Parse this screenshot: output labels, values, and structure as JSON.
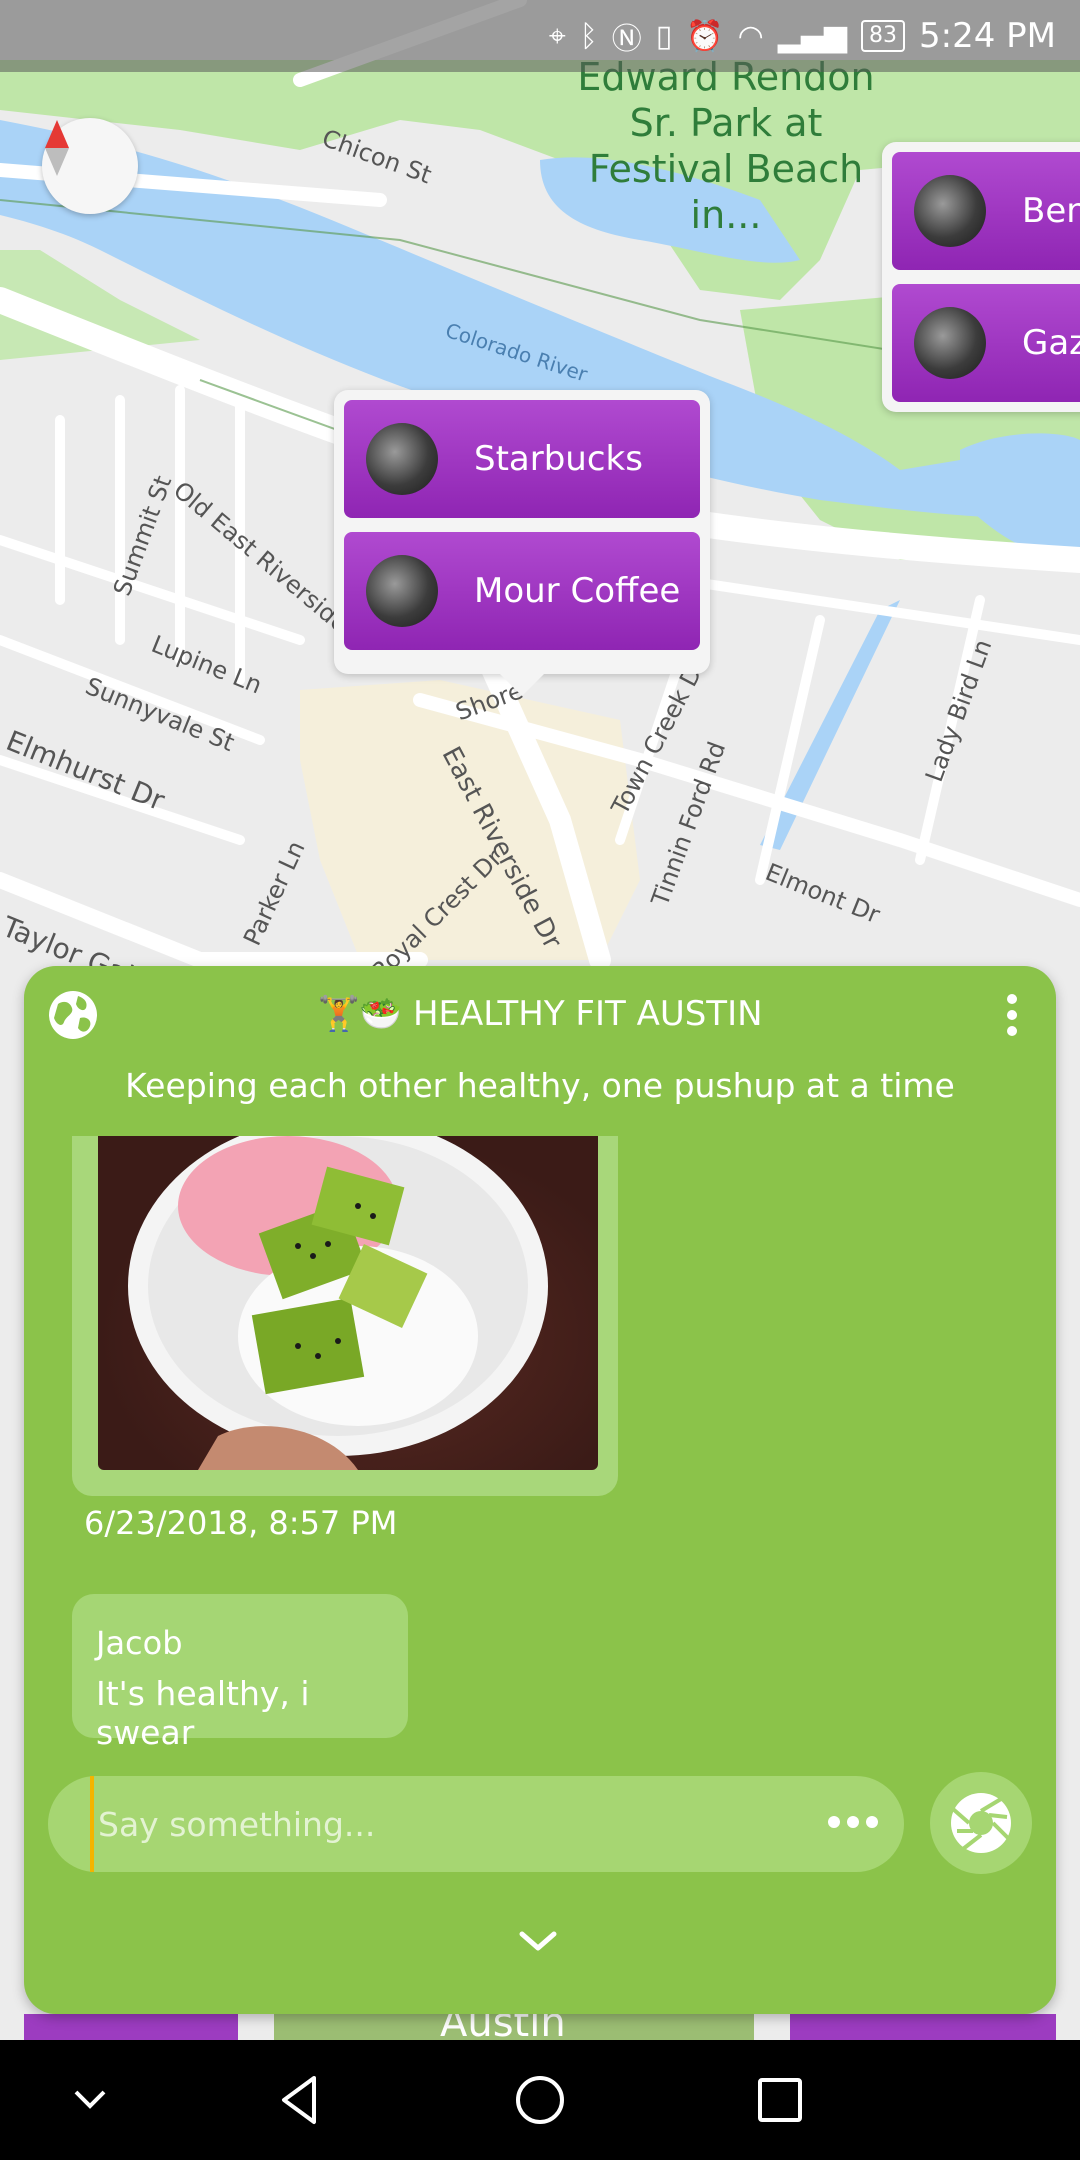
{
  "status_bar": {
    "battery": "83",
    "time": "5:24 PM",
    "icons": [
      "location-icon",
      "bluetooth-icon",
      "nfc-icon",
      "vibrate-icon",
      "alarm-icon",
      "wifi-icon",
      "signal-icon"
    ]
  },
  "map": {
    "street_labels": [
      "Chicon St",
      "Colorado River",
      "Old East Riverside Dr",
      "Summit St",
      "Lupine Ln",
      "Sunnyvale St",
      "Elmhurst Dr",
      "Taylor Gaines St",
      "Parker Ln",
      "Royal Crest Dr",
      "East Riverside Dr",
      "Shore",
      "Town Creek Dr",
      "Tinnin Ford Rd",
      "Lady Bird Ln",
      "Elmont Dr"
    ],
    "park_label": "Edward Rendon Sr. Park at Festival Beach in...",
    "popup_a": {
      "places": [
        {
          "name": "Starbucks"
        },
        {
          "name": "Mour Coffee"
        }
      ]
    },
    "popup_b": {
      "places": [
        {
          "name": "Ben"
        },
        {
          "name": "Gaz"
        }
      ]
    },
    "behind_label": "Austin"
  },
  "chat": {
    "title_emoji": "🏋️🥗",
    "title": "HEALTHY FIT AUSTIN",
    "subtitle": "Keeping each other healthy, one pushup at a time",
    "message_timestamp": "6/23/2018, 8:57 PM",
    "message": {
      "author": "Jacob",
      "text": "It's healthy, i swear"
    },
    "input_placeholder": "Say something..."
  },
  "colors": {
    "panel": "#8bc34a",
    "place_button": "#a43bc6",
    "water": "#aad3f7",
    "park": "#bfe6a8"
  }
}
